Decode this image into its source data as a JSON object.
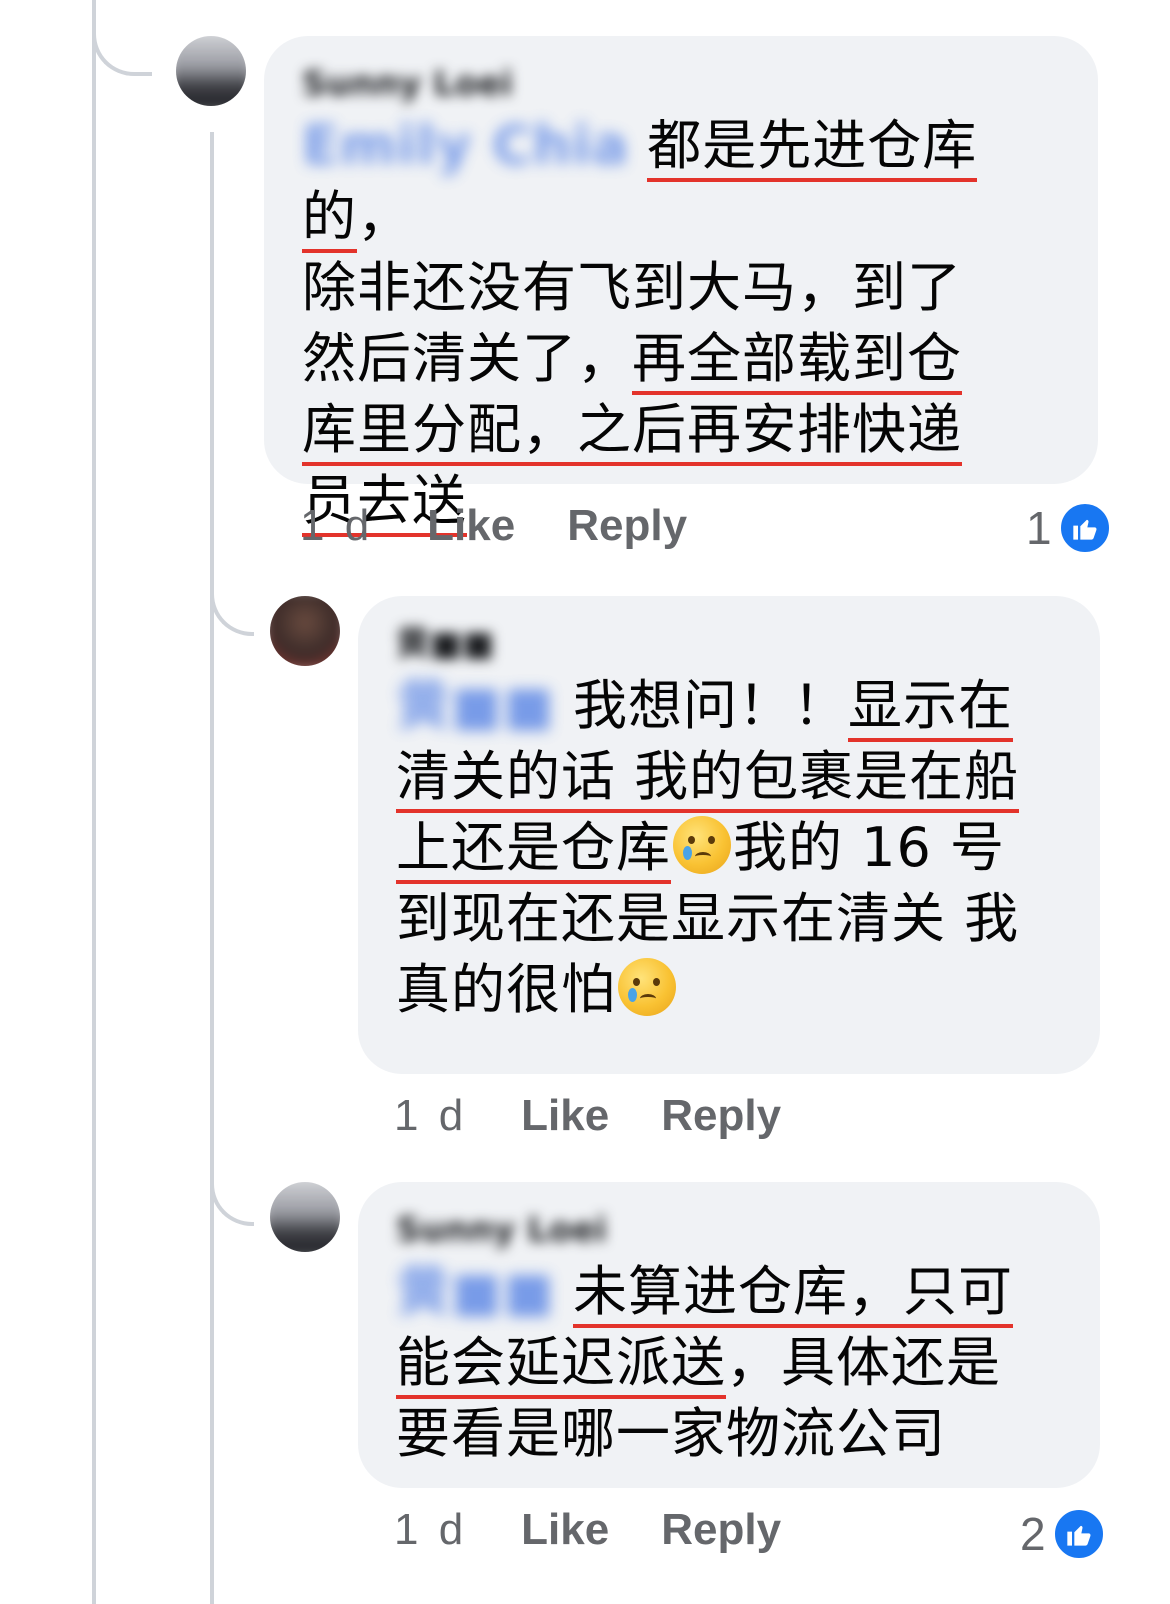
{
  "comments": [
    {
      "author": "Sunny Loei",
      "mention": "Emily Chia",
      "segments": [
        {
          "text": "都是先进仓库的",
          "u": true
        },
        {
          "text": "，\n除非还没有飞到大马，到了\n然后清关了，",
          "u": false
        },
        {
          "text": "再全部载到仓\n库里分配，之后再安排快递\n员去送",
          "u": true
        }
      ],
      "time": "1 d",
      "like_label": "Like",
      "reply_label": "Reply",
      "reaction_count": "1"
    },
    {
      "author": "黄■■",
      "mention": "黄■■",
      "segments": [
        {
          "text": "我想问！！",
          "u": false
        },
        {
          "text": "显示在\n清关的话 我的包裹是在船\n上还是仓库",
          "u": true
        },
        {
          "emoji": "crying-face"
        },
        {
          "text": "我的 16 号\n到现在还是显示在清关 我\n真的很怕",
          "u": false
        },
        {
          "emoji": "crying-face"
        }
      ],
      "time": "1 d",
      "like_label": "Like",
      "reply_label": "Reply",
      "reaction_count": ""
    },
    {
      "author": "Sunny Loei",
      "mention": "黄■■",
      "segments": [
        {
          "text": "未算进仓库，只可\n能会延迟派送",
          "u": true
        },
        {
          "text": "，具体还是\n要看是哪一家物流公司",
          "u": false
        }
      ],
      "time": "1 d",
      "like_label": "Like",
      "reply_label": "Reply",
      "reaction_count": "2"
    }
  ],
  "colors": {
    "bubble": "#f0f2f5",
    "underline": "#e3332b",
    "like_blue": "#1877f2",
    "meta_gray": "#65676b"
  }
}
